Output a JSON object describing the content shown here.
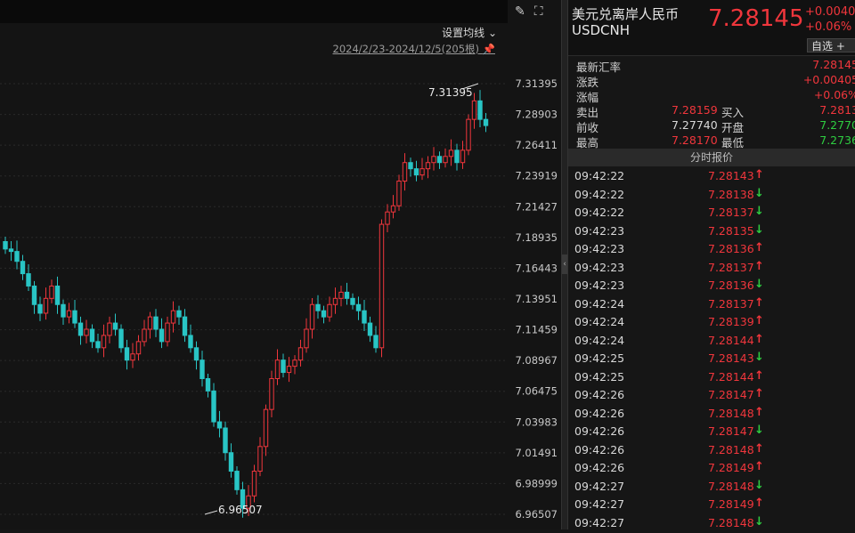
{
  "toolbar": {
    "settings_label": "设置均线",
    "date_range": "2024/2/23-2024/12/5(205根)",
    "pin_icon": "pin-icon",
    "edit_icon": "pencil-icon",
    "expand_icon": "expand-icon"
  },
  "chart_data": {
    "type": "candlestick",
    "y_ticks": [
      "7.31395",
      "7.28903",
      "7.26411",
      "7.23919",
      "7.21427",
      "7.18935",
      "7.16443",
      "7.13951",
      "7.11459",
      "7.08967",
      "7.06475",
      "7.03983",
      "7.01491",
      "6.98999",
      "6.96507"
    ],
    "ylim": [
      6.96507,
      7.31395
    ],
    "high_label": "7.31395",
    "low_label": "6.96507",
    "up_color": "#f0363c",
    "down_color": "#29c5c5",
    "closes": [
      7.18,
      7.178,
      7.17,
      7.16,
      7.15,
      7.135,
      7.128,
      7.14,
      7.15,
      7.135,
      7.125,
      7.13,
      7.12,
      7.11,
      7.115,
      7.105,
      7.1,
      7.11,
      7.12,
      7.115,
      7.1,
      7.09,
      7.095,
      7.105,
      7.115,
      7.125,
      7.115,
      7.105,
      7.12,
      7.13,
      7.125,
      7.11,
      7.1,
      7.09,
      7.075,
      7.065,
      7.04,
      7.035,
      7.015,
      7.0,
      6.985,
      6.97,
      6.98,
      7.0,
      7.02,
      7.05,
      7.075,
      7.09,
      7.08,
      7.085,
      7.09,
      7.1,
      7.115,
      7.135,
      7.13,
      7.125,
      7.135,
      7.14,
      7.145,
      7.14,
      7.135,
      7.13,
      7.12,
      7.11,
      7.1,
      7.2,
      7.21,
      7.215,
      7.235,
      7.25,
      7.245,
      7.24,
      7.245,
      7.25,
      7.255,
      7.25,
      7.255,
      7.26,
      7.25,
      7.26,
      7.285,
      7.3,
      7.285,
      7.28
    ]
  },
  "quote": {
    "name": "美元兑离岸人民币",
    "code": "USDCNH",
    "price": "7.28145",
    "change": "+0.0040",
    "change_pct": "+0.06%",
    "watch_label": "自选 +",
    "stats": {
      "latest_label": "最新汇率",
      "latest": "7.28145",
      "change_label": "涨跌",
      "change": "+0.00405",
      "pct_label": "涨幅",
      "pct": "+0.06%",
      "sell_label": "卖出",
      "sell": "7.28159",
      "buy_label": "买入",
      "buy": "7.2813",
      "prev_label": "前收",
      "prev": "7.27740",
      "open_label": "开盘",
      "open": "7.2770",
      "high_label": "最高",
      "high": "7.28170",
      "low_label": "最低",
      "low": "7.2736"
    },
    "ticks_title": "分时报价",
    "ticks": [
      {
        "time": "09:42:22",
        "price": "7.28143",
        "dir": "up"
      },
      {
        "time": "09:42:22",
        "price": "7.28138",
        "dir": "down"
      },
      {
        "time": "09:42:22",
        "price": "7.28137",
        "dir": "down"
      },
      {
        "time": "09:42:23",
        "price": "7.28135",
        "dir": "down"
      },
      {
        "time": "09:42:23",
        "price": "7.28136",
        "dir": "up"
      },
      {
        "time": "09:42:23",
        "price": "7.28137",
        "dir": "up"
      },
      {
        "time": "09:42:23",
        "price": "7.28136",
        "dir": "down"
      },
      {
        "time": "09:42:24",
        "price": "7.28137",
        "dir": "up"
      },
      {
        "time": "09:42:24",
        "price": "7.28139",
        "dir": "up"
      },
      {
        "time": "09:42:24",
        "price": "7.28144",
        "dir": "up"
      },
      {
        "time": "09:42:25",
        "price": "7.28143",
        "dir": "down"
      },
      {
        "time": "09:42:25",
        "price": "7.28144",
        "dir": "up"
      },
      {
        "time": "09:42:26",
        "price": "7.28147",
        "dir": "up"
      },
      {
        "time": "09:42:26",
        "price": "7.28148",
        "dir": "up"
      },
      {
        "time": "09:42:26",
        "price": "7.28147",
        "dir": "down"
      },
      {
        "time": "09:42:26",
        "price": "7.28148",
        "dir": "up"
      },
      {
        "time": "09:42:26",
        "price": "7.28149",
        "dir": "up"
      },
      {
        "time": "09:42:27",
        "price": "7.28148",
        "dir": "down"
      },
      {
        "time": "09:42:27",
        "price": "7.28149",
        "dir": "up"
      },
      {
        "time": "09:42:27",
        "price": "7.28148",
        "dir": "down"
      }
    ]
  }
}
